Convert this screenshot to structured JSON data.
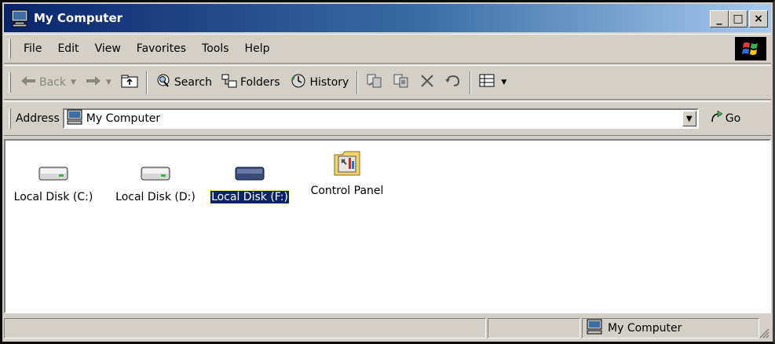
{
  "window": {
    "title": "My Computer",
    "controls": {
      "minimize": "_",
      "maximize": "□",
      "close": "×"
    }
  },
  "menubar": {
    "items": [
      "File",
      "Edit",
      "View",
      "Favorites",
      "Tools",
      "Help"
    ],
    "logo_icon": "windows-flag-icon"
  },
  "toolbar": {
    "back_label": "Back",
    "search_label": "Search",
    "folders_label": "Folders",
    "history_label": "History",
    "icons": [
      "back-arrow-icon",
      "forward-arrow-icon",
      "up-folder-icon",
      "search-icon",
      "folders-icon",
      "history-icon",
      "move-to-icon",
      "copy-to-icon",
      "delete-icon",
      "undo-icon",
      "views-icon"
    ]
  },
  "address": {
    "label": "Address",
    "value": "My Computer",
    "go_label": "Go"
  },
  "items": [
    {
      "label": "Local Disk (C:)",
      "icon": "hard-drive-icon",
      "selected": false
    },
    {
      "label": "Local Disk (D:)",
      "icon": "hard-drive-icon",
      "selected": false
    },
    {
      "label": "Local Disk (F:)",
      "icon": "hard-drive-icon",
      "selected": true
    },
    {
      "label": "Control Panel",
      "icon": "control-panel-icon",
      "selected": false
    }
  ],
  "status": {
    "location": "My Computer"
  },
  "colors": {
    "title_start": "#0a246a",
    "title_end": "#a6caf0",
    "face": "#d4d0c8",
    "selection": "#0a246a"
  }
}
